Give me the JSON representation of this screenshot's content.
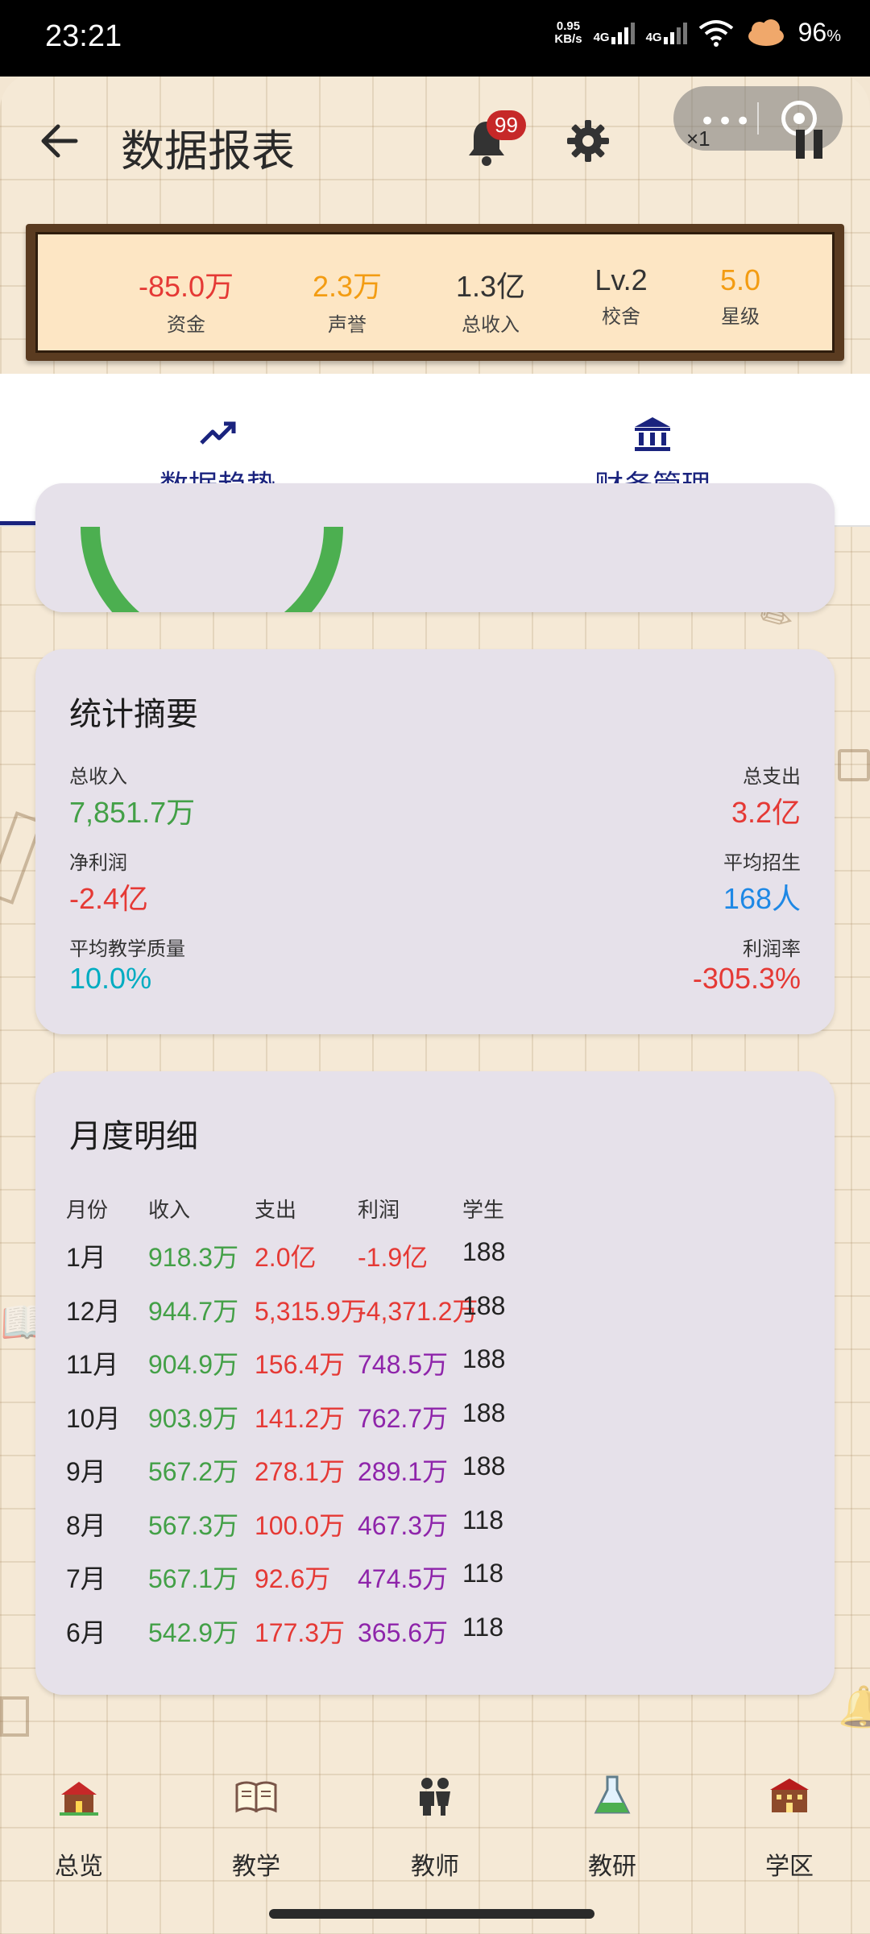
{
  "status_bar": {
    "time": "23:21",
    "net_speed_value": "0.95",
    "net_speed_unit": "KB/s",
    "signal1": "4G",
    "signal2": "4G",
    "battery": "96",
    "battery_unit": "%"
  },
  "header": {
    "title": "数据报表",
    "notification_badge": "99",
    "speed_multiplier": "×1"
  },
  "stats": [
    {
      "value": "-85.0万",
      "label": "资金",
      "color": "#e53935"
    },
    {
      "value": "2.3万",
      "label": "声誉",
      "color": "#f39c12"
    },
    {
      "value": "1.3亿",
      "label": "总收入",
      "color": "#333333"
    },
    {
      "value": "Lv.2",
      "label": "校舍",
      "color": "#333333"
    },
    {
      "value": "5.0",
      "label": "星级",
      "color": "#f39c12"
    }
  ],
  "tabs": [
    {
      "label": "数据趋势",
      "icon": "trending-up-icon",
      "active": true
    },
    {
      "label": "财务管理",
      "icon": "bank-icon",
      "active": false
    }
  ],
  "summary": {
    "title": "统计摘要",
    "total_income_label": "总收入",
    "total_income": "7,851.7万",
    "total_expense_label": "总支出",
    "total_expense": "3.2亿",
    "net_profit_label": "净利润",
    "net_profit": "-2.4亿",
    "avg_enroll_label": "平均招生",
    "avg_enroll": "168人",
    "avg_quality_label": "平均教学质量",
    "avg_quality": "10.0%",
    "profit_rate_label": "利润率",
    "profit_rate": "-305.3%"
  },
  "monthly": {
    "title": "月度明细",
    "headers": [
      "月份",
      "收入",
      "支出",
      "利润",
      "学生"
    ],
    "rows": [
      {
        "month": "1月",
        "income": "918.3万",
        "expense": "2.0亿",
        "profit": "-1.9亿",
        "profit_negative": true,
        "students": "188"
      },
      {
        "month": "12月",
        "income": "944.7万",
        "expense": "5,315.9万",
        "profit": "-4,371.2万",
        "profit_negative": true,
        "students": "188"
      },
      {
        "month": "11月",
        "income": "904.9万",
        "expense": "156.4万",
        "profit": "748.5万",
        "profit_negative": false,
        "students": "188"
      },
      {
        "month": "10月",
        "income": "903.9万",
        "expense": "141.2万",
        "profit": "762.7万",
        "profit_negative": false,
        "students": "188"
      },
      {
        "month": "9月",
        "income": "567.2万",
        "expense": "278.1万",
        "profit": "289.1万",
        "profit_negative": false,
        "students": "188"
      },
      {
        "month": "8月",
        "income": "567.3万",
        "expense": "100.0万",
        "profit": "467.3万",
        "profit_negative": false,
        "students": "118"
      },
      {
        "month": "7月",
        "income": "567.1万",
        "expense": "92.6万",
        "profit": "474.5万",
        "profit_negative": false,
        "students": "118"
      },
      {
        "month": "6月",
        "income": "542.9万",
        "expense": "177.3万",
        "profit": "365.6万",
        "profit_negative": false,
        "students": "118"
      }
    ]
  },
  "colors": {
    "income": "#43a047",
    "expense": "#e53935",
    "profit_positive": "#8e24aa",
    "profit_negative": "#e53935",
    "blue": "#1e88e5",
    "cyan": "#00acc1",
    "nav_accent": "#1a237e"
  },
  "bottom_nav": [
    {
      "label": "总览",
      "icon": "school-house-icon"
    },
    {
      "label": "教学",
      "icon": "open-book-icon"
    },
    {
      "label": "教师",
      "icon": "teachers-icon"
    },
    {
      "label": "教研",
      "icon": "flask-icon"
    },
    {
      "label": "学区",
      "icon": "campus-building-icon"
    }
  ]
}
